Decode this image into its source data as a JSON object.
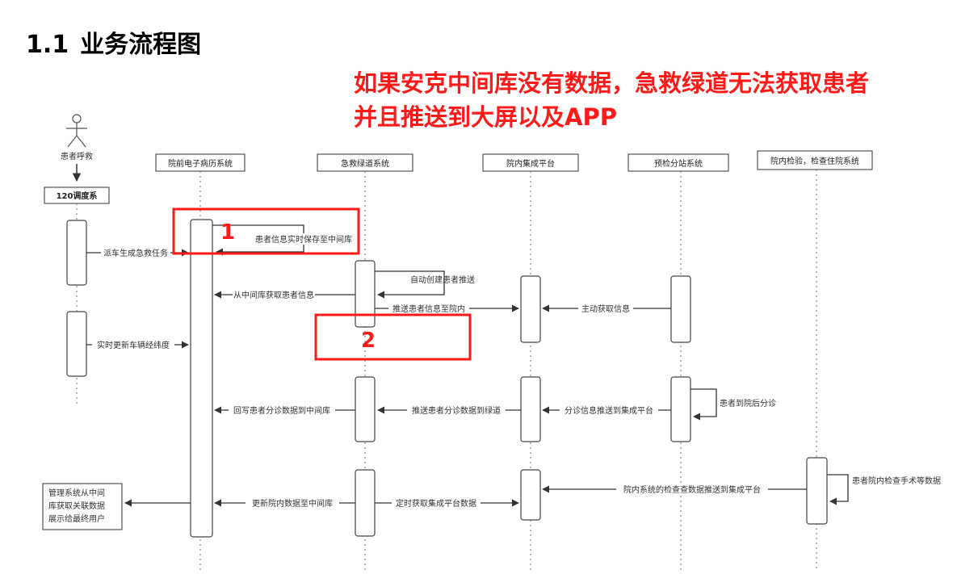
{
  "heading": {
    "number": "1.1",
    "title": "业务流程图"
  },
  "note": {
    "line1": "如果安克中间库没有数据，急救绿道无法获取患者",
    "line2": "并且推送到大屏以及APP"
  },
  "actor": {
    "label": "患者呼救"
  },
  "dispatch": {
    "label": "120调度系"
  },
  "lanes": [
    {
      "label": "院前电子病历系统"
    },
    {
      "label": "急救绿道系统"
    },
    {
      "label": "院内集成平台"
    },
    {
      "label": "预检分站系统"
    },
    {
      "label": "院内检验，检查住院系统"
    }
  ],
  "messages": {
    "save_realtime": "患者信息实时保存至中间库",
    "dispatch_task": "派车生成急救任务",
    "auto_create": "自动创建患者推送",
    "fetch_patient": "从中间库获取患者信息",
    "push_to_hospital": "推送患者信息至院内",
    "active_fetch": "主动获取信息",
    "update_gps": "实时更新车辆经纬度",
    "writeback_triage": "回写患者分诊数据到中间库",
    "push_triage": "推送患者分诊数据到绿道",
    "triage_to_platform": "分诊信息推送到集成平台",
    "triage_after_arrival": "患者到院后分诊",
    "inhospital_to_platform": "院内系统的检查查数据推送到集成平台",
    "inhospital_exams": "患者院内检查手术等数据",
    "update_inhospital": "更新院内数据至中间库",
    "timed_fetch": "定时获取集成平台数据"
  },
  "management_note": {
    "line1": "管理系统从中间",
    "line2": "库获取关联数据",
    "line3": "展示给最终用户"
  },
  "markers": {
    "one": "1",
    "two": "2"
  },
  "colors": {
    "highlight": "#ff1a1a",
    "line": "#333333",
    "lifeline": "#888888"
  }
}
